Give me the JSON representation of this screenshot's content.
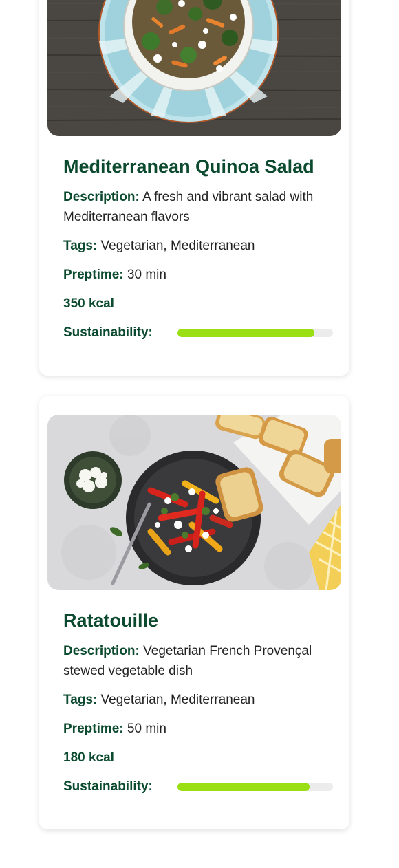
{
  "recipes": [
    {
      "title": "Mediterranean Quinoa Salad",
      "description_label": "Description:",
      "description": "A fresh and vibrant salad with Mediterranean flavors",
      "tags_label": "Tags:",
      "tags": "Vegetarian, Mediterranean",
      "preptime_label": "Preptime:",
      "preptime": "30 min",
      "calories": "350 kcal",
      "sustainability_label": "Sustainability:",
      "sustainability_fraction": 0.88,
      "image_alt": "Quinoa salad in a blue patterned bowl"
    },
    {
      "title": "Ratatouille",
      "description_label": "Description:",
      "description": "Vegetarian French Provençal stewed vegetable dish",
      "tags_label": "Tags:",
      "tags": "Vegetarian, Mediterranean",
      "preptime_label": "Preptime:",
      "preptime": "50 min",
      "calories": "180 kcal",
      "sustainability_label": "Sustainability:",
      "sustainability_fraction": 0.85,
      "image_alt": "Roasted pepper dish with feta and bread"
    }
  ],
  "colors": {
    "heading": "#0b4a2e",
    "bar_fill": "#9ade14",
    "bar_track": "#ececec"
  }
}
